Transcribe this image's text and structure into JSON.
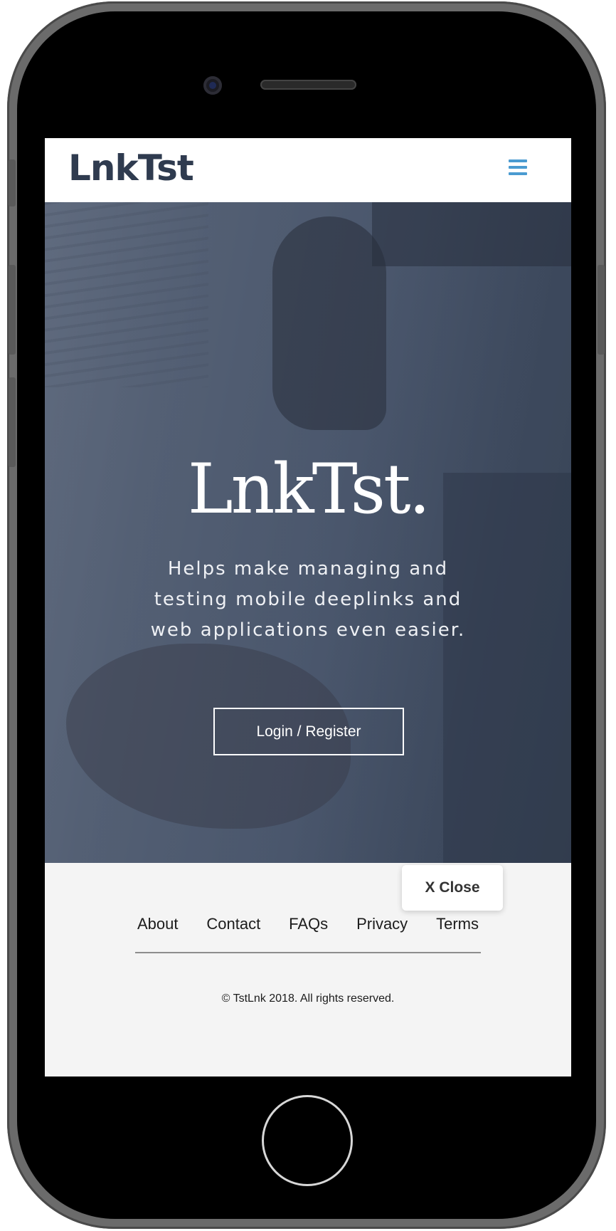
{
  "header": {
    "brand": "LnkTst",
    "menu_icon": "hamburger-menu-icon",
    "accent_color": "#4a9bd1"
  },
  "hero": {
    "title": "LnkTst.",
    "subtitle": "Helps make managing and testing mobile deeplinks and web applications even easier.",
    "cta_label": "Login / Register"
  },
  "footer": {
    "links": [
      "About",
      "Contact",
      "FAQs",
      "Privacy",
      "Terms"
    ],
    "copyright": "© TstLnk 2018. All rights reserved."
  },
  "overlay": {
    "close_label": "X Close"
  }
}
